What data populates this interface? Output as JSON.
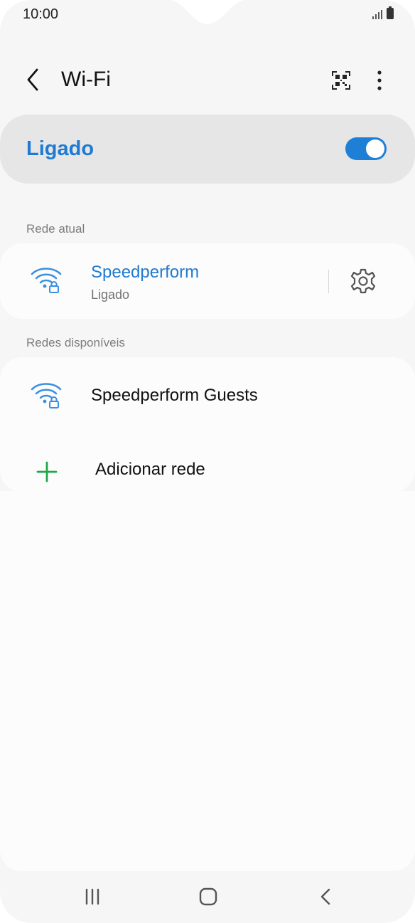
{
  "status_bar": {
    "time": "10:00",
    "icons": [
      "signal-icon",
      "battery-icon"
    ]
  },
  "app_bar": {
    "title": "Wi-Fi",
    "icons": [
      "back-icon",
      "qr-code-icon",
      "more-options-icon"
    ]
  },
  "master_switch": {
    "label": "Ligado",
    "enabled": true
  },
  "current_network": {
    "header": "Rede atual",
    "name": "Speedperform",
    "status": "Ligado"
  },
  "available_networks": {
    "header": "Redes disponíveis",
    "items": [
      {
        "name": "Speedperform Guests",
        "secured": true
      }
    ],
    "add_label": "Adicionar rede"
  },
  "nav_bar": {
    "buttons": [
      "recents-button",
      "home-button",
      "back-button"
    ]
  },
  "colors": {
    "accent": "#1f7bd1",
    "wifi_icon": "#3a8fe0",
    "add_icon": "#1fa84a",
    "background": "#f6f6f6",
    "card": "#fcfcfc"
  }
}
